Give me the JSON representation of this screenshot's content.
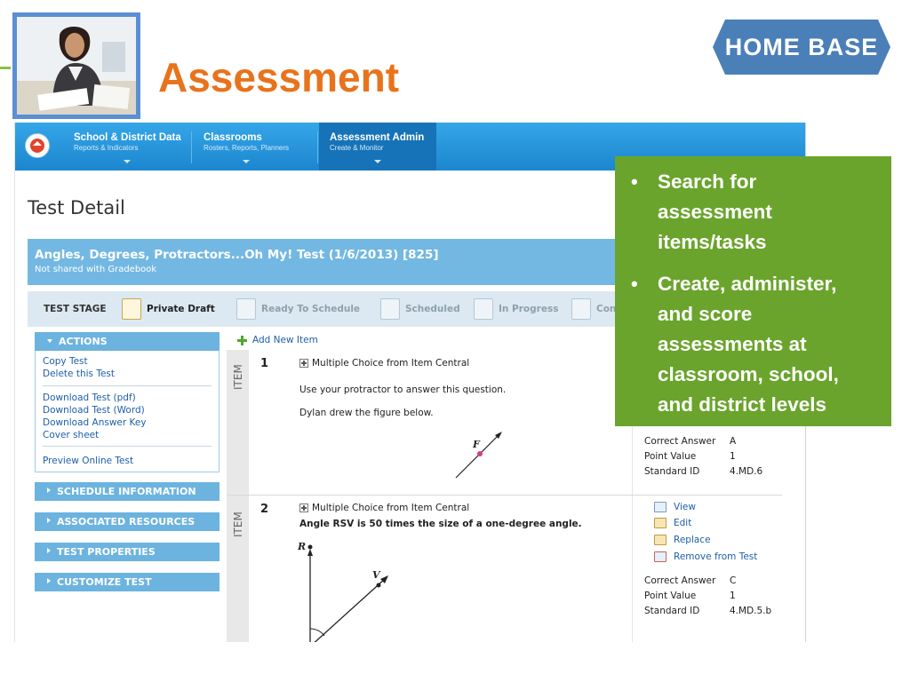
{
  "slide": {
    "title": "Assessment",
    "logo_text": "HOME BASE",
    "accent_color": "#e8731c",
    "callout_color": "#6aa42c"
  },
  "callout": {
    "bullets": [
      "Search for assessment items/tasks",
      "Create, administer, and score assessments at classroom, school, and district levels"
    ]
  },
  "nav": {
    "tabs": [
      {
        "title": "School & District Data",
        "subtitle": "Reports & Indicators"
      },
      {
        "title": "Classrooms",
        "subtitle": "Rosters, Reports, Planners"
      },
      {
        "title": "Assessment Admin",
        "subtitle": "Create & Monitor"
      }
    ]
  },
  "page": {
    "heading": "Test Detail",
    "test_name": "Angles, Degrees, Protractors...Oh My! Test (1/6/2013) [825]",
    "test_sub": "Not shared with Gradebook"
  },
  "stages": {
    "label": "TEST STAGE",
    "items": [
      "Private Draft",
      "Ready To Schedule",
      "Scheduled",
      "In Progress",
      "Con"
    ]
  },
  "actions": {
    "header": "ACTIONS",
    "links": [
      "Copy Test",
      "Delete this Test",
      "Download Test (pdf)",
      "Download Test (Word)",
      "Download Answer Key",
      "Cover sheet",
      "Preview Online Test"
    ]
  },
  "panels": [
    "SCHEDULE INFORMATION",
    "ASSOCIATED RESOURCES",
    "TEST PROPERTIES",
    "CUSTOMIZE TEST"
  ],
  "items": {
    "add_label": "Add New Item",
    "rail_label": "ITEM",
    "meta_labels": [
      "Correct Answer",
      "Point Value",
      "Standard ID"
    ],
    "links": [
      "View",
      "Edit",
      "Replace",
      "Remove from Test"
    ],
    "list": [
      {
        "number": "1",
        "type": "Multiple Choice from Item Central",
        "line1": "Use your protractor to answer this question.",
        "line2": "Dylan drew the figure below.",
        "figure_point": "F",
        "correct_answer": "A",
        "point_value": "1",
        "standard_id": "4.MD.6"
      },
      {
        "number": "2",
        "type": "Multiple Choice from Item Central",
        "line1": "Angle RSV is 50 times the size of a one-degree angle.",
        "figure_point_r": "R",
        "figure_point_v": "V",
        "correct_answer": "C",
        "point_value": "1",
        "standard_id": "4.MD.5.b"
      }
    ]
  }
}
